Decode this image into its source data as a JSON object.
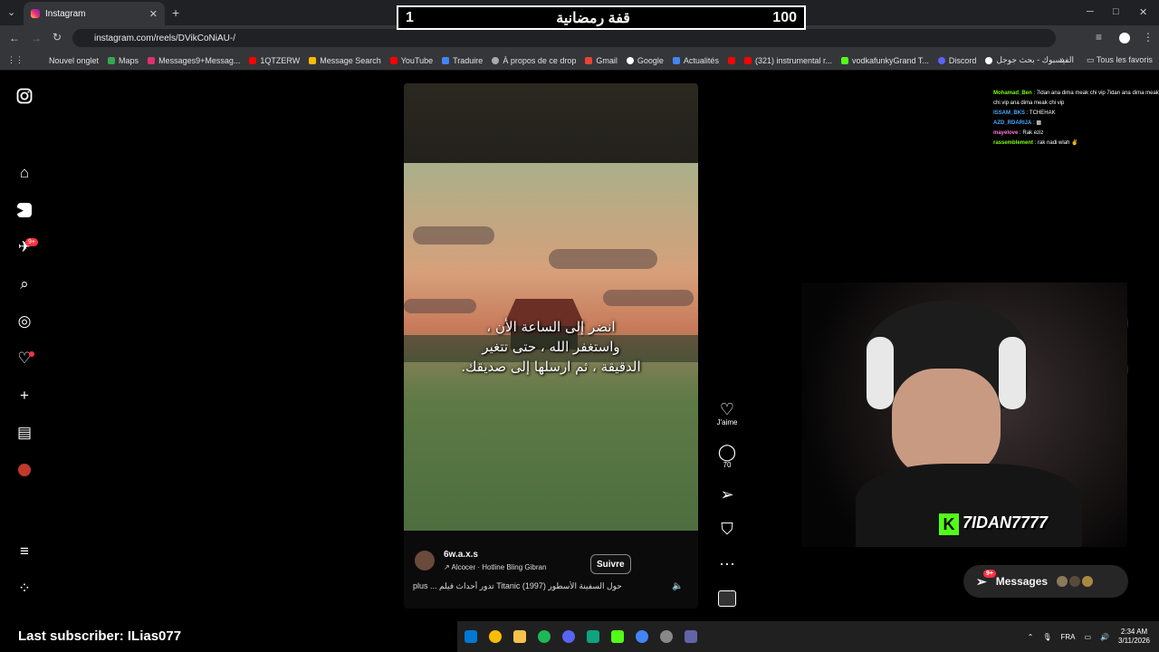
{
  "browser": {
    "tab_title": "Instagram",
    "url": "instagram.com/reels/DVikCoNiAU-/",
    "new_tab": "+",
    "win_min": "─",
    "win_max": "□",
    "win_close": "✕",
    "bookmarks": [
      "Nouvel onglet",
      "Maps",
      "Messages9+Messag...",
      "1QTZERW",
      "Message Search",
      "YouTube",
      "Traduire",
      "À propos de ce drop",
      "Gmail",
      "Google",
      "Actualités",
      "(321) instrumental r...",
      "vodkafunkyGrand T...",
      "Discord",
      "الفيسبوك - بحث جوجل"
    ],
    "all_bookmarks": "Tous les favoris"
  },
  "overlay": {
    "left_count": "1",
    "title": "قفة رمضانية",
    "right_count": "100"
  },
  "nav": {
    "notif_badge": "9+"
  },
  "reel": {
    "caption_lines": [
      "انضر إلى الساعة الأن ،",
      "واستغفر الله ، حتى تتغير",
      "الدقيقة ، ثم ارسلها إلى صديقك."
    ],
    "username": "6w.a.x.s",
    "music": "↗  Alcocer · Hotline Bling        Gibran",
    "follow": "Suivre",
    "description": "plus ...  تدور أحداث فيلم Titanic (1997) حول السفينة الأسطور",
    "like_label": "J'aime",
    "comment_count": "70"
  },
  "chat": [
    {
      "user": "Mohamad_Ben",
      "msg": "7idan ana dima meak chi vip 7idan ana dima meak chi vip ana dima meak chi vip",
      "color": "#7CFC00"
    },
    {
      "user": "ISSAM_BKS",
      "msg": "TCHEHAK",
      "color": "#4aa8ff"
    },
    {
      "user": "AZD_RDARIJA",
      "msg": "▩",
      "color": "#4aa8ff"
    },
    {
      "user": "mayelove",
      "msg": "Rak eziz",
      "color": "#ff7ad9"
    },
    {
      "user": "rassemblement",
      "msg": "rak nadi wlah ✌",
      "color": "#7CFC00"
    }
  ],
  "stream": {
    "streamer": "7IDAN7777",
    "last_subscriber": "Last subscriber: ILias077"
  },
  "messages": {
    "label": "Messages",
    "badge": "9+"
  },
  "taskbar": {
    "lang": "FRA",
    "time": "2:34 AM",
    "date": "3/11/2026"
  }
}
